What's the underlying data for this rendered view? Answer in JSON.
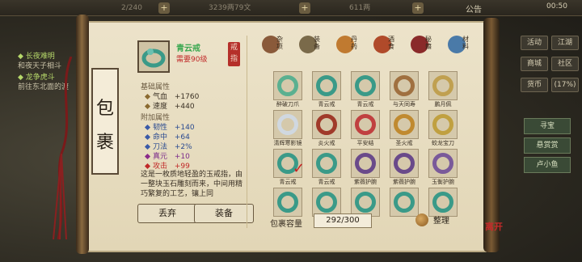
{
  "topbar": {
    "res1": "2/240",
    "res2": "3239两79文",
    "res3": "611两",
    "notice": "公告",
    "clock": "00:50"
  },
  "quests": [
    {
      "title": "◆ 长夜难明",
      "sub": "和夜天子相斗"
    },
    {
      "title": "◆ 龙争虎斗",
      "sub": "前往东北面的渡"
    }
  ],
  "right_menu": {
    "btn1": "活动",
    "btn2": "江湖",
    "btn3": "商城",
    "btn4": "社区",
    "market": "货币",
    "market_val": "(17%)"
  },
  "side_tabs": [
    "寻宝",
    "悬赏赏",
    "卢小鱼"
  ],
  "panel_title": [
    "包",
    "裹"
  ],
  "item": {
    "name": "青云戒",
    "level": "需要90级",
    "seal": "戒指",
    "base_title": "基础属性",
    "base": [
      {
        "label": "气血",
        "value": "+1760"
      },
      {
        "label": "速度",
        "value": "+440"
      }
    ],
    "extra_title": "附加属性",
    "extra": [
      {
        "label": "韧性",
        "value": "+140"
      },
      {
        "label": "命中",
        "value": "+64"
      },
      {
        "label": "刀法",
        "value": "+2%"
      },
      {
        "label": "真元",
        "value": "+10"
      },
      {
        "label": "攻击",
        "value": "+99"
      }
    ],
    "description": "这是一枚质地轻盈的玉戒指，由一整块玉石雕刻而来，中间用精巧繁复的工艺，镶上同",
    "discard": "丢弃",
    "equip": "装备"
  },
  "categories": [
    {
      "label": "杂项",
      "color": "#8a5a3a"
    },
    {
      "label": "装备",
      "color": "#7a6a4a"
    },
    {
      "label": "丹药",
      "color": "#c07a30"
    },
    {
      "label": "酒食",
      "color": "#b04a2a"
    },
    {
      "label": "秘籍",
      "color": "#8a2a2a"
    },
    {
      "label": "材料",
      "color": "#4a7aa8"
    }
  ],
  "slots": [
    {
      "label": "醉破刀爪",
      "ring": "#5ab090"
    },
    {
      "label": "青云戒",
      "ring": "#3a9a88"
    },
    {
      "label": "青云戒",
      "ring": "#3a9a88"
    },
    {
      "label": "与天同寿",
      "ring": "#a07040"
    },
    {
      "label": "鹏月佩",
      "ring": "#c0a050"
    },
    {
      "label": "清辉寒影镜",
      "ring": "#d0d8e0"
    },
    {
      "label": "炎火戒",
      "ring": "#a03a2a"
    },
    {
      "label": "平安结",
      "ring": "#c04040"
    },
    {
      "label": "圣火戒",
      "ring": "#c08a30"
    },
    {
      "label": "蛟龙宝刀",
      "ring": "#c0a040"
    },
    {
      "label": "青云戒",
      "ring": "#3a9a88"
    },
    {
      "label": "青云戒",
      "ring": "#3a9a88"
    },
    {
      "label": "紫薇护腕",
      "ring": "#6a4a8a"
    },
    {
      "label": "紫薇护腕",
      "ring": "#6a4a8a"
    },
    {
      "label": "玉衡护腕",
      "ring": "#7a5a9a"
    },
    {
      "label": "",
      "ring": "#3a9a88"
    },
    {
      "label": "",
      "ring": "#3a9a88"
    },
    {
      "label": "",
      "ring": "#3a9a88"
    },
    {
      "label": "",
      "ring": "#3a9a88"
    },
    {
      "label": "",
      "ring": "#3a9a88"
    }
  ],
  "capacity_label": "包裹容量",
  "capacity_value": "292/300",
  "sort_label": "整理",
  "brand_mark": "离开"
}
